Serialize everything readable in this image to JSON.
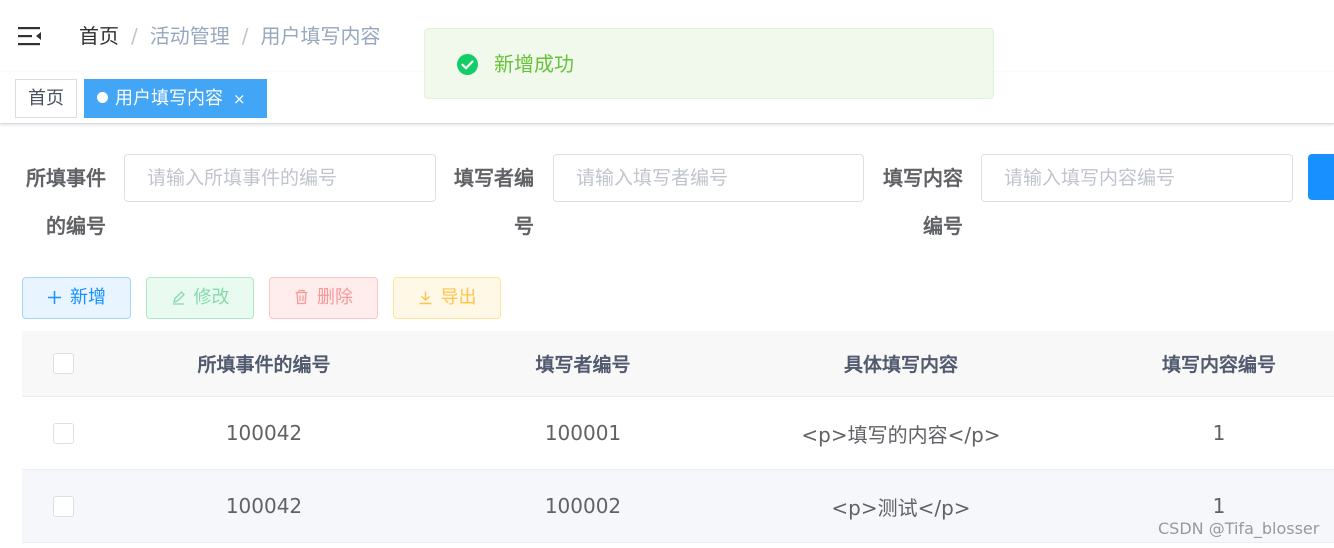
{
  "navbar": {
    "menu_icon": "hamburger-fold-icon",
    "breadcrumb": [
      "首页",
      "活动管理",
      "用户填写内容"
    ],
    "separator": "/"
  },
  "tags_view": {
    "tags": [
      {
        "label": "首页",
        "active": false
      },
      {
        "label": "用户填写内容",
        "active": true,
        "close": "×"
      }
    ]
  },
  "toast": {
    "icon": "success-check-icon",
    "message": "新增成功",
    "color": "#67c23a"
  },
  "search_form": {
    "fields": [
      {
        "label_line1": "所填事件",
        "label_line2": "的编号",
        "placeholder": "请输入所填事件的编号",
        "value": ""
      },
      {
        "label_line1": "填写者编",
        "label_line2": "号",
        "placeholder": "请输入填写者编号",
        "value": ""
      },
      {
        "label_line1": "填写内容",
        "label_line2": "编号",
        "placeholder": "请输入填写内容编号",
        "value": ""
      }
    ],
    "search_icon": "search-icon"
  },
  "toolbar": {
    "add": "新增",
    "edit": "修改",
    "delete": "删除",
    "export": "导出"
  },
  "table": {
    "columns": [
      "所填事件的编号",
      "填写者编号",
      "具体填写内容",
      "填写内容编号"
    ],
    "rows": [
      [
        "100042",
        "100001",
        "<p>填写的内容</p>",
        "1"
      ],
      [
        "100042",
        "100002",
        "<p>测试</p>",
        "1"
      ]
    ]
  },
  "watermark": "CSDN @Tifa_blosser",
  "colors": {
    "primary": "#1890ff",
    "success": "#13ce66",
    "danger": "#ff4949",
    "warning": "#ffba00",
    "active_tag": "#42a5f5"
  }
}
